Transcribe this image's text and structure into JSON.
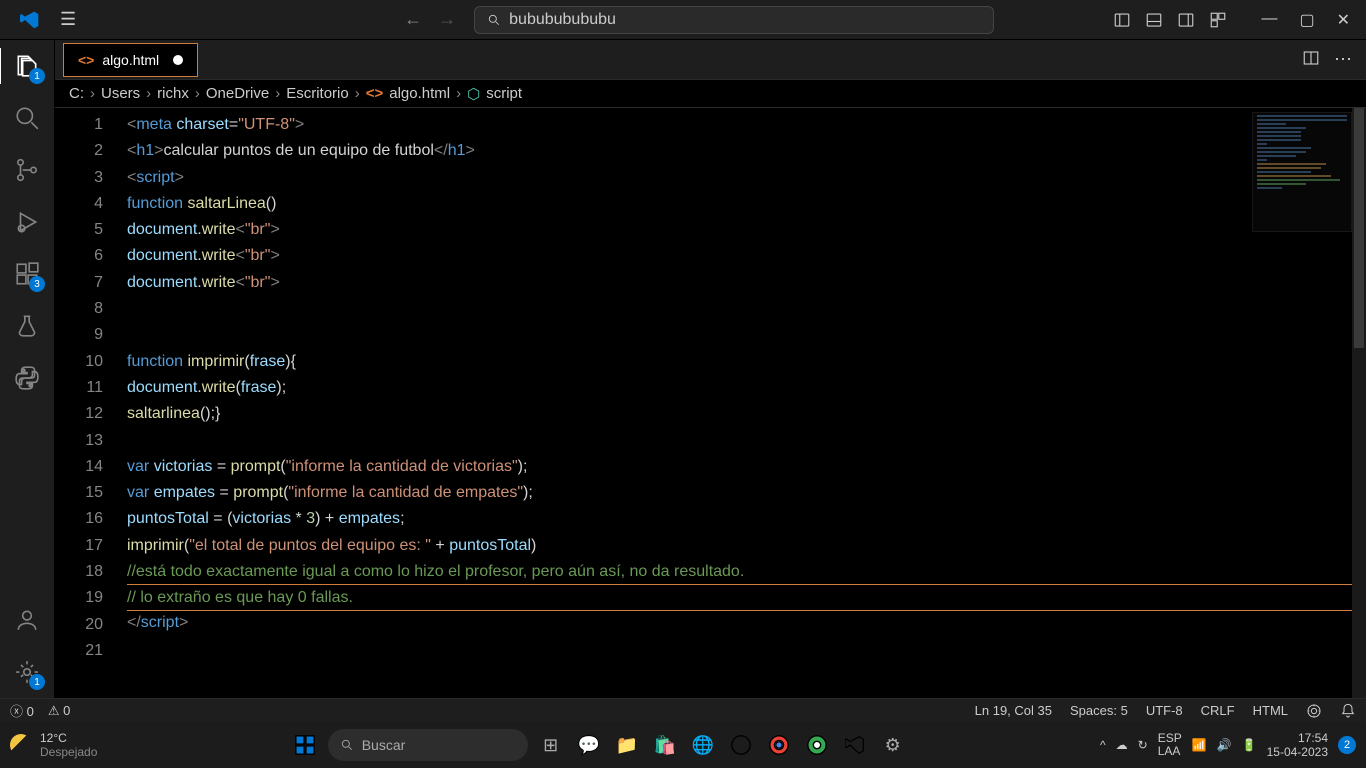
{
  "titlebar": {
    "search_text": "bubububububu"
  },
  "tab": {
    "filename": "algo.html"
  },
  "breadcrumbs": [
    "C:",
    "Users",
    "richx",
    "OneDrive",
    "Escritorio",
    "algo.html",
    "script"
  ],
  "activitybar": {
    "explorer_badge": "1",
    "extensions_badge": "3",
    "settings_badge": "1"
  },
  "code_lines": [
    {
      "n": 1,
      "html": "<span class='t-brkt'>&lt;</span><span class='t-tag'>meta</span> <span class='t-attr'>charset</span>=<span class='t-str'>\"UTF-8\"</span><span class='t-brkt'>&gt;</span>"
    },
    {
      "n": 2,
      "html": "<span class='t-brkt'>&lt;</span><span class='t-tag'>h1</span><span class='t-brkt'>&gt;</span>calcular puntos de un equipo de futbol<span class='t-brkt'>&lt;/</span><span class='t-tag'>h1</span><span class='t-brkt'>&gt;</span>"
    },
    {
      "n": 3,
      "html": "<span class='t-brkt'>&lt;</span><span class='t-tag'>script</span><span class='t-brkt'>&gt;</span>"
    },
    {
      "n": 4,
      "html": "<span class='t-kw'>function</span> <span class='t-fn'>saltarLinea</span>()"
    },
    {
      "n": 5,
      "html": "<span class='t-var'>document</span>.<span class='t-fn'>write</span><span class='t-brkt'>&lt;</span><span class='t-str'>\"br\"</span><span class='t-brkt'>&gt;</span>"
    },
    {
      "n": 6,
      "html": "<span class='t-var'>document</span>.<span class='t-fn'>write</span><span class='t-brkt'>&lt;</span><span class='t-str'>\"br\"</span><span class='t-brkt'>&gt;</span>"
    },
    {
      "n": 7,
      "html": "<span class='t-var'>document</span>.<span class='t-fn'>write</span><span class='t-brkt'>&lt;</span><span class='t-str'>\"br\"</span><span class='t-brkt'>&gt;</span>"
    },
    {
      "n": 8,
      "html": ""
    },
    {
      "n": 9,
      "html": ""
    },
    {
      "n": 10,
      "html": "<span class='t-kw'>function</span> <span class='t-fn'>imprimir</span>(<span class='t-var'>frase</span>){"
    },
    {
      "n": 11,
      "html": "<span class='t-var'>document</span>.<span class='t-fn'>write</span>(<span class='t-var'>frase</span>);"
    },
    {
      "n": 12,
      "html": "<span class='t-fn'>saltarlinea</span>();}"
    },
    {
      "n": 13,
      "html": ""
    },
    {
      "n": 14,
      "html": "<span class='t-kw'>var</span> <span class='t-var'>victorias</span> = <span class='t-fn'>prompt</span>(<span class='t-str'>\"informe la cantidad de victorias\"</span>);"
    },
    {
      "n": 15,
      "html": "<span class='t-kw'>var</span> <span class='t-var'>empates</span> = <span class='t-fn'>prompt</span>(<span class='t-str'>\"informe la cantidad de empates\"</span>);"
    },
    {
      "n": 16,
      "html": "<span class='t-var'>puntosTotal</span> = (<span class='t-var'>victorias</span> * <span class='t-num'>3</span>) + <span class='t-var'>empates</span>;"
    },
    {
      "n": 17,
      "html": "<span class='t-fn'>imprimir</span>(<span class='t-str'>\"el total de puntos del equipo es: \"</span> + <span class='t-var'>puntosTotal</span>)"
    },
    {
      "n": 18,
      "html": "<span class='t-cmt'>//está todo exactamente igual a como lo hizo el profesor, pero aún así, no da resultado.</span>"
    },
    {
      "n": 19,
      "html": "<span class='t-cmt'>// lo extraño es que hay 0 fallas.</span>",
      "hl": true
    },
    {
      "n": 20,
      "html": "<span class='t-brkt'>&lt;/</span><span class='t-tag'>script</span><span class='t-brkt'>&gt;</span>"
    },
    {
      "n": 21,
      "html": ""
    }
  ],
  "statusbar": {
    "errors": "0",
    "warnings": "0",
    "cursor": "Ln 19, Col 35",
    "spaces": "Spaces: 5",
    "encoding": "UTF-8",
    "eol": "CRLF",
    "lang": "HTML"
  },
  "taskbar": {
    "weather_temp": "12°C",
    "weather_desc": "Despejado",
    "search_placeholder": "Buscar",
    "lang1": "ESP",
    "lang2": "LAA",
    "time": "17:54",
    "date": "15-04-2023",
    "notif_count": "2"
  }
}
